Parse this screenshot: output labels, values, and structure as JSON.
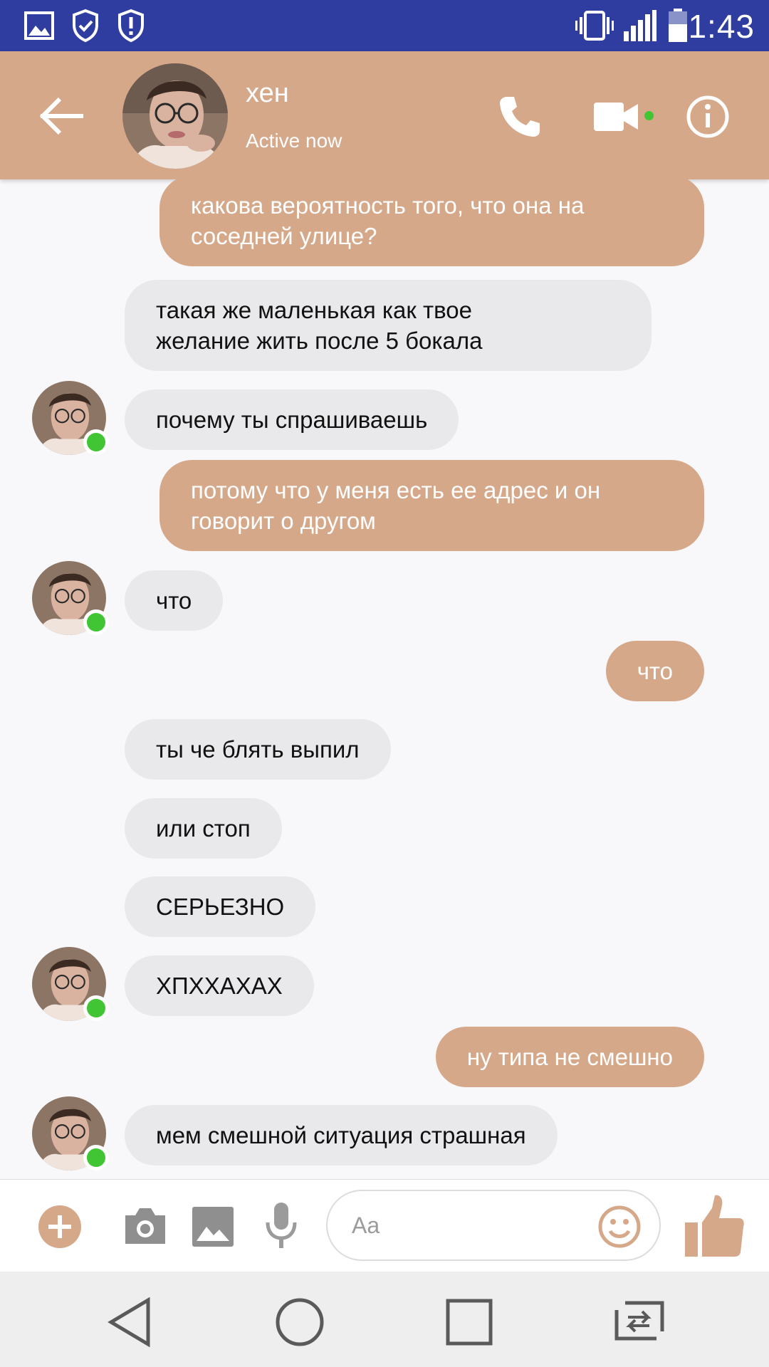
{
  "status_bar": {
    "time": "1:43",
    "left_icons": [
      "gallery-notification-icon",
      "shield-check-icon",
      "alert-shield-icon"
    ],
    "right_icons": [
      "vibrate-icon",
      "signal-icon",
      "battery-icon"
    ]
  },
  "header": {
    "contact_name": "хен",
    "status": "Active now",
    "online_indicator_color": "#41c535",
    "icons": [
      "back-arrow-icon",
      "phone-icon",
      "video-call-icon",
      "info-icon"
    ]
  },
  "conversation": {
    "messages": [
      {
        "direction": "out",
        "text": [
          "какова вероятность того, что она на",
          "соседней улице?"
        ]
      },
      {
        "direction": "in",
        "text": [
          "такая же маленькая как твое",
          "желание жить после 5 бокала"
        ]
      },
      {
        "direction": "in",
        "text": [
          "почему ты спрашиваешь"
        ]
      },
      {
        "direction": "out",
        "text": [
          "потому что у меня есть ее адрес и он",
          "говорит о другом"
        ]
      },
      {
        "direction": "in",
        "text": [
          "что"
        ]
      },
      {
        "direction": "out",
        "text": [
          "что"
        ]
      },
      {
        "direction": "in",
        "text": [
          "ты че блять выпил"
        ]
      },
      {
        "direction": "in",
        "text": [
          "или стоп"
        ]
      },
      {
        "direction": "in",
        "text": [
          "СЕРЬЕЗНО"
        ]
      },
      {
        "direction": "in",
        "text": [
          "ХПХХАХАХ"
        ]
      },
      {
        "direction": "out",
        "text": [
          "ну типа не смешно"
        ]
      },
      {
        "direction": "in",
        "text": [
          "мем смешной ситуация страшная"
        ]
      }
    ]
  },
  "composer": {
    "placeholder": "Aa",
    "icons": [
      "add-icon",
      "camera-icon",
      "image-icon",
      "microphone-icon",
      "emoji-icon",
      "thumbs-up-icon"
    ]
  },
  "nav_bar": {
    "icons": [
      "nav-back-icon",
      "nav-home-icon",
      "nav-recents-icon",
      "nav-switch-icon"
    ]
  },
  "colors": {
    "accent": "#d6a88a",
    "status_bar": "#2e3d9f",
    "incoming_bubble": "#e9e9ec",
    "online": "#41c535"
  }
}
